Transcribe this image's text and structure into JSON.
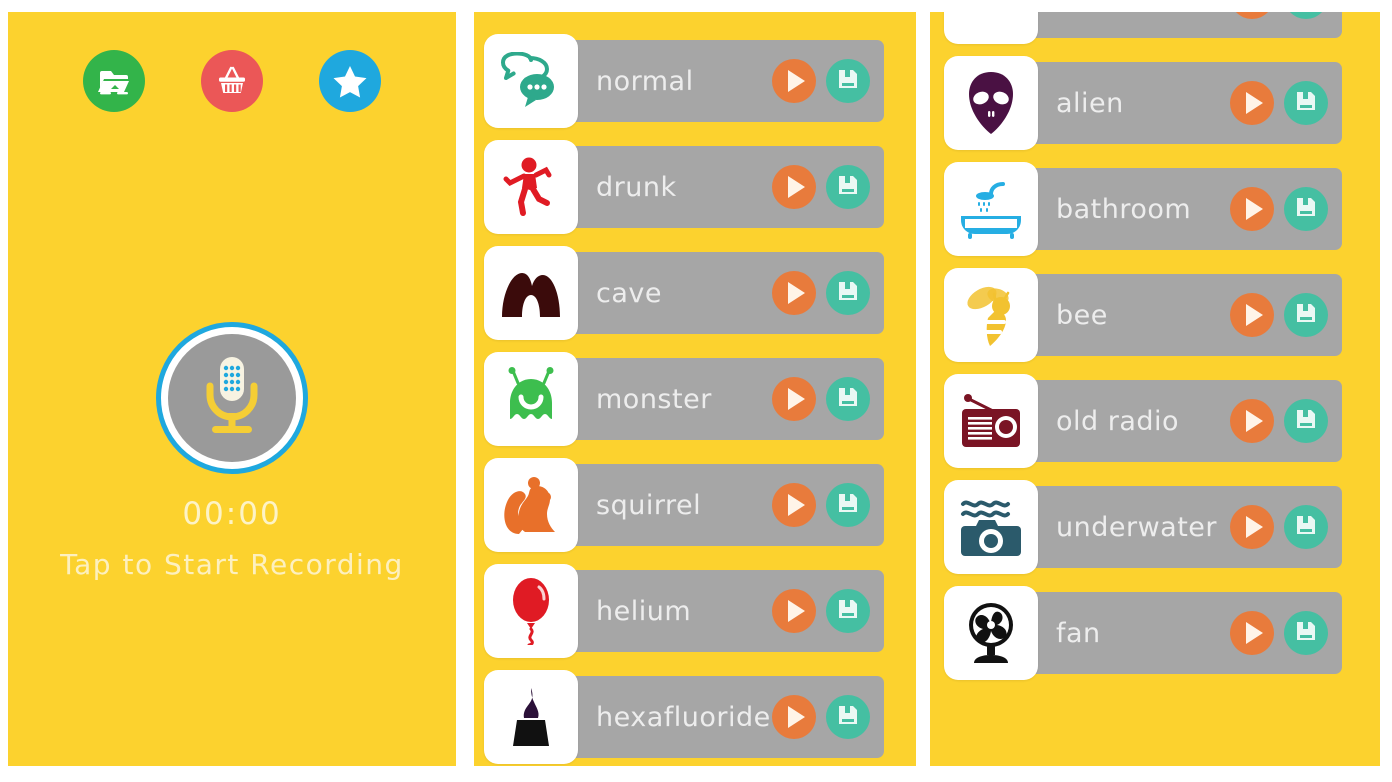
{
  "colors": {
    "background_yellow": "#FCD22E",
    "row_gray": "#A6A6A6",
    "play_orange": "#E87B3C",
    "save_teal": "#45BFA2",
    "mic_ring_blue": "#1FA8DE",
    "mic_body_gray": "#9A9A9A",
    "label_text": "#EDEDED",
    "hint_text": "#FDF0BF"
  },
  "recorder": {
    "top_buttons": [
      {
        "name": "folder-button",
        "icon": "folder-icon",
        "color": "#33B44A"
      },
      {
        "name": "store-button",
        "icon": "basket-icon",
        "color": "#EB5757"
      },
      {
        "name": "favorites-button",
        "icon": "star-icon",
        "color": "#1FA8DE"
      }
    ],
    "mic_button_icon": "microphone-icon",
    "timer": "00:00",
    "hint": "Tap to Start Recording"
  },
  "effects_list_a": {
    "play_label": "play",
    "save_label": "save",
    "items": [
      {
        "label": "normal",
        "icon": "chat-bubbles-icon",
        "icon_color": "#2EA98C"
      },
      {
        "label": "drunk",
        "icon": "dancing-person-icon",
        "icon_color": "#E01B24"
      },
      {
        "label": "cave",
        "icon": "cave-arch-icon",
        "icon_color": "#3B0B0B"
      },
      {
        "label": "monster",
        "icon": "monster-blob-icon",
        "icon_color": "#3DBE4E"
      },
      {
        "label": "squirrel",
        "icon": "squirrel-icon",
        "icon_color": "#E8702A"
      },
      {
        "label": "helium",
        "icon": "balloon-icon",
        "icon_color": "#E01B24"
      },
      {
        "label": "hexafluoride",
        "icon": "dark-figure-icon",
        "icon_color": "#2B1038"
      }
    ]
  },
  "effects_list_b": {
    "items": [
      {
        "label": "",
        "icon": "arc-icon",
        "icon_color": "#C2622A"
      },
      {
        "label": "alien",
        "icon": "alien-head-icon",
        "icon_color": "#4A1143"
      },
      {
        "label": "bathroom",
        "icon": "bathtub-shower-icon",
        "icon_color": "#26AEE3"
      },
      {
        "label": "bee",
        "icon": "bee-icon",
        "icon_color": "#F2C230"
      },
      {
        "label": "old radio",
        "icon": "radio-icon",
        "icon_color": "#7A1424"
      },
      {
        "label": "underwater",
        "icon": "camera-waves-icon",
        "icon_color": "#2B5A6B"
      },
      {
        "label": "fan",
        "icon": "fan-icon",
        "icon_color": "#111111"
      }
    ]
  }
}
